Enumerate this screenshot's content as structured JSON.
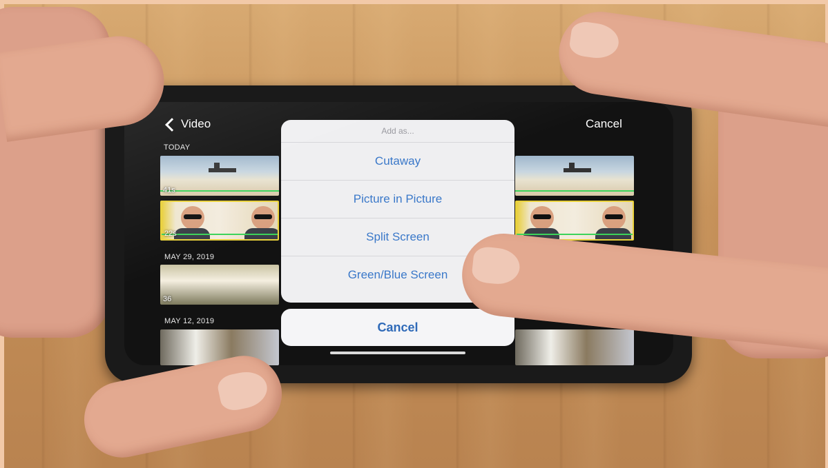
{
  "nav": {
    "back_label": "Video",
    "cancel_label": "Cancel"
  },
  "sections": [
    {
      "label": "TODAY",
      "clips": [
        {
          "duration": "41s"
        },
        {
          "duration": "22s"
        }
      ]
    },
    {
      "label": "MAY 29, 2019",
      "clips": [
        {
          "duration": "36"
        }
      ]
    },
    {
      "label": "MAY 12, 2019",
      "clips": [
        {
          "duration": ""
        }
      ]
    }
  ],
  "action_sheet": {
    "title": "Add as...",
    "options": [
      "Cutaway",
      "Picture in Picture",
      "Split Screen",
      "Green/Blue Screen"
    ],
    "cancel_label": "Cancel"
  },
  "colors": {
    "accent": "#3a78c9",
    "timeline_green": "#3cd35a",
    "clip_highlight": "#ead23b"
  },
  "icons": {
    "back": "chevron-left-icon"
  }
}
